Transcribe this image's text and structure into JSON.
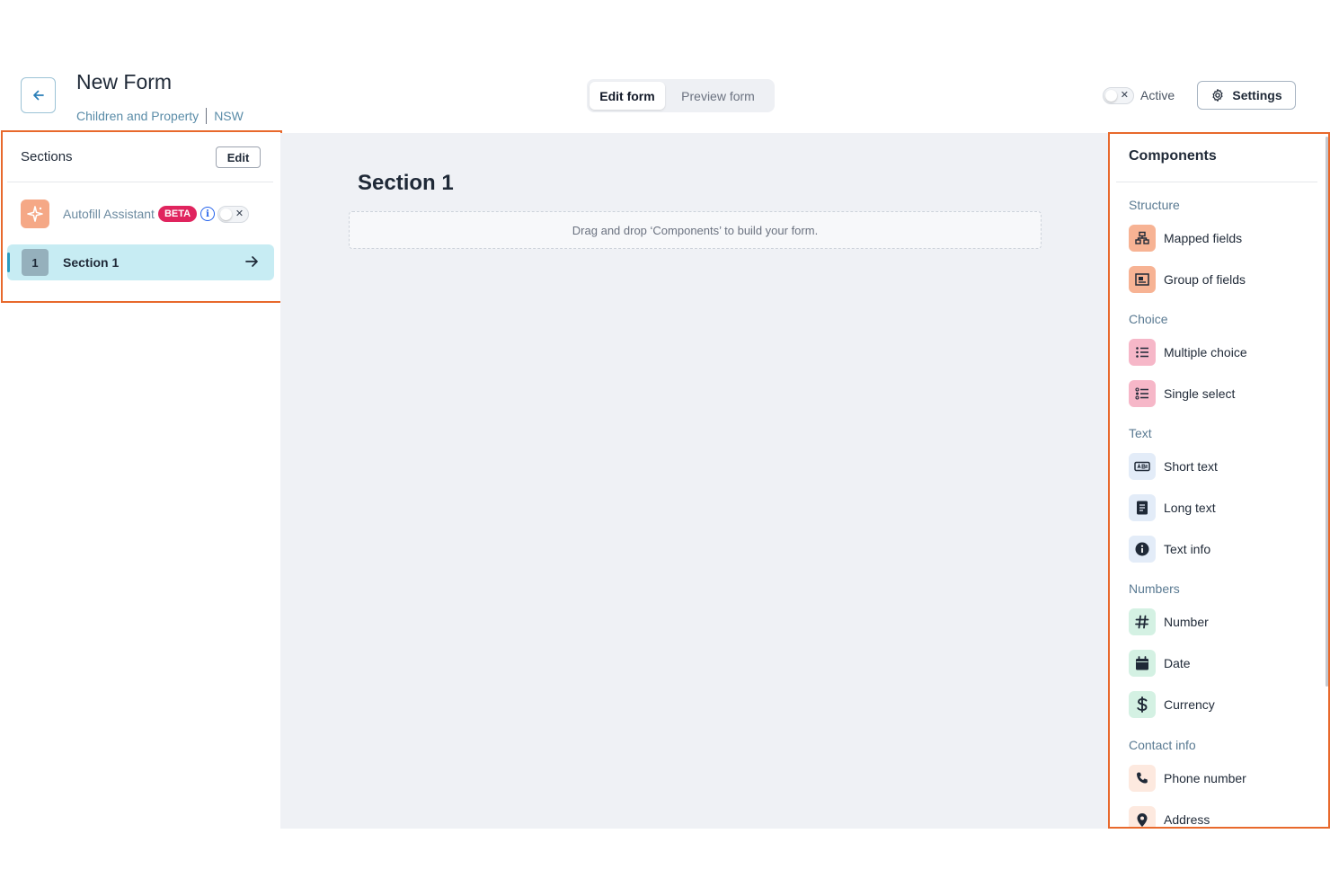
{
  "header": {
    "title": "New Form",
    "category": "Children and Property",
    "region": "NSW",
    "modes": [
      "Edit form",
      "Preview form"
    ],
    "active_label": "Active",
    "settings_label": "Settings"
  },
  "sections_panel": {
    "title": "Sections",
    "edit_label": "Edit",
    "autofill": {
      "label": "Autofill Assistant",
      "badge": "BETA",
      "enabled": false
    },
    "items": [
      {
        "number": "1",
        "label": "Section 1"
      }
    ]
  },
  "canvas": {
    "heading": "Section 1",
    "dropzone_text": "Drag and drop ‘Components’ to build your form."
  },
  "components": {
    "title": "Components",
    "groups": [
      {
        "label": "Structure",
        "items": [
          {
            "label": "Mapped fields",
            "icon": "mapped-fields-icon"
          },
          {
            "label": "Group of fields",
            "icon": "group-fields-icon"
          }
        ]
      },
      {
        "label": "Choice",
        "items": [
          {
            "label": "Multiple choice",
            "icon": "list-icon"
          },
          {
            "label": "Single select",
            "icon": "list-select-icon"
          }
        ]
      },
      {
        "label": "Text",
        "items": [
          {
            "label": "Short text",
            "icon": "text-field-icon"
          },
          {
            "label": "Long text",
            "icon": "document-icon"
          },
          {
            "label": "Text info",
            "icon": "info-icon"
          }
        ]
      },
      {
        "label": "Numbers",
        "items": [
          {
            "label": "Number",
            "icon": "hash-icon"
          },
          {
            "label": "Date",
            "icon": "calendar-icon"
          },
          {
            "label": "Currency",
            "icon": "dollar-icon"
          }
        ]
      },
      {
        "label": "Contact info",
        "items": [
          {
            "label": "Phone number",
            "icon": "phone-icon"
          },
          {
            "label": "Address",
            "icon": "map-pin-icon"
          }
        ]
      }
    ]
  },
  "colors": {
    "highlight": "#e8692c",
    "selected_section": "#c7ecf3",
    "beta": "#e0245e"
  }
}
